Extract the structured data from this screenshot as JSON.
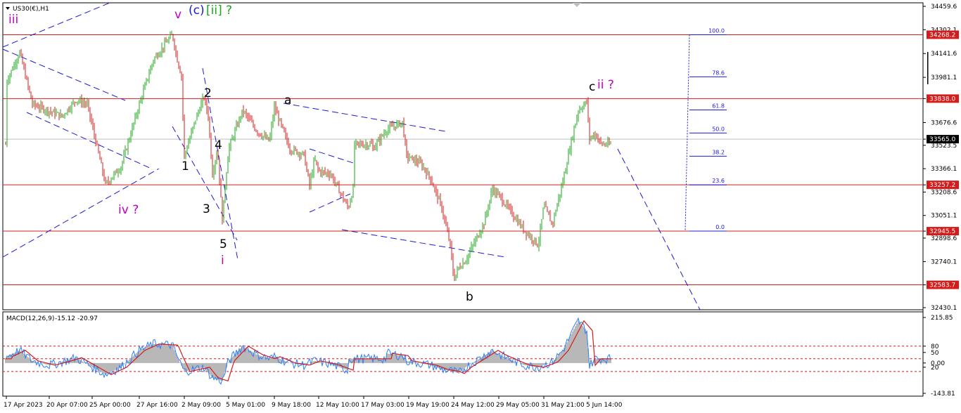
{
  "header": {
    "symbol": "US30(€),H1",
    "macd_label": "MACD(12,26,9)",
    "macd_value": "-15.12",
    "macd_signal": "-20.97"
  },
  "colors": {
    "bull": "#1aa81a",
    "bear": "#d41c1c",
    "level": "#d41c1c",
    "trend": "#1b1bd6",
    "price_badge": "#d41c1c",
    "current_badge": "#000000",
    "histogram": "#b8b8b8",
    "macd_line": "#2a7fff",
    "signal_line": "#d41c1c"
  },
  "chart_data": [
    {
      "type": "candlestick",
      "ylim": [
        32430.1,
        34459.6
      ],
      "y_ticks": [
        "34459.6",
        "34302.1",
        "34141.6",
        "33981.1",
        "33838.0",
        "33676.6",
        "33565.0",
        "33523.5",
        "33366.1",
        "33257.2",
        "33208.6",
        "33051.1",
        "32945.5",
        "32898.6",
        "32740.1",
        "32583.7",
        "32430.1"
      ],
      "x_ticks": [
        "17 Apr 2023",
        "20 Apr 07:00",
        "25 Apr 00:00",
        "27 Apr 16:00",
        "2 May 09:00",
        "5 May 01:00",
        "9 May 18:00",
        "12 May 10:00",
        "17 May 03:00",
        "19 May 19:00",
        "24 May 12:00",
        "29 May 05:00",
        "31 May 21:00",
        "5 Jun 14:00"
      ],
      "key_points": [
        {
          "x": "17 Apr 2023",
          "y": 33950
        },
        {
          "x": "18 Apr",
          "y": 34150
        },
        {
          "x": "19 Apr",
          "y": 33800
        },
        {
          "x": "21 Apr",
          "y": 33720
        },
        {
          "x": "24 Apr",
          "y": 33830
        },
        {
          "x": "25 Apr",
          "y": 33800
        },
        {
          "x": "26 Apr",
          "y": 33260
        },
        {
          "x": "27 Apr",
          "y": 33380
        },
        {
          "x": "27 Apr 16:00",
          "y": 33800
        },
        {
          "x": "28 Apr",
          "y": 34100
        },
        {
          "x": "1 May",
          "y": 34270
        },
        {
          "x": "1 May 12:00",
          "y": 34100
        },
        {
          "x": "2 May 06:00",
          "y": 33990
        },
        {
          "x": "2 May 09:00",
          "y": 33450
        },
        {
          "x": "2 May 16:00",
          "y": 33700
        },
        {
          "x": "3 May",
          "y": 33850
        },
        {
          "x": "3 May 08:00",
          "y": 33720
        },
        {
          "x": "3 May 18:00",
          "y": 33330
        },
        {
          "x": "4 May",
          "y": 33500
        },
        {
          "x": "4 May 10:00",
          "y": 33020
        },
        {
          "x": "4 May 18:00",
          "y": 33250
        },
        {
          "x": "5 May 01:00",
          "y": 33500
        },
        {
          "x": "5 May 12:00",
          "y": 33760
        },
        {
          "x": "8 May",
          "y": 33620
        },
        {
          "x": "9 May",
          "y": 33550
        },
        {
          "x": "9 May 18:00",
          "y": 33780
        },
        {
          "x": "10 May",
          "y": 33500
        },
        {
          "x": "11 May",
          "y": 33460
        },
        {
          "x": "11 May 18:00",
          "y": 33250
        },
        {
          "x": "12 May",
          "y": 33430
        },
        {
          "x": "12 May 10:00",
          "y": 33350
        },
        {
          "x": "15 May",
          "y": 33330
        },
        {
          "x": "16 May",
          "y": 33100
        },
        {
          "x": "16 May 12:00",
          "y": 33250
        },
        {
          "x": "17 May",
          "y": 33450
        },
        {
          "x": "17 May 12:00",
          "y": 33500
        },
        {
          "x": "18 May",
          "y": 33630
        },
        {
          "x": "18 May 12:00",
          "y": 33680
        },
        {
          "x": "19 May",
          "y": 33450
        },
        {
          "x": "19 May 12:00",
          "y": 33400
        },
        {
          "x": "22 May",
          "y": 33300
        },
        {
          "x": "23 May",
          "y": 33100
        },
        {
          "x": "23 May 12:00",
          "y": 32850
        },
        {
          "x": "24 May",
          "y": 32700
        },
        {
          "x": "24 May 12:00",
          "y": 32620
        },
        {
          "x": "25 May",
          "y": 32750
        },
        {
          "x": "25 May 12:00",
          "y": 33000
        },
        {
          "x": "26 May",
          "y": 33230
        },
        {
          "x": "29 May",
          "y": 33180
        },
        {
          "x": "29 May 12:00",
          "y": 33050
        },
        {
          "x": "30 May",
          "y": 32950
        },
        {
          "x": "30 May 12:00",
          "y": 32880
        },
        {
          "x": "31 May",
          "y": 32850
        },
        {
          "x": "31 May 12:00",
          "y": 32990
        },
        {
          "x": "31 May 21:00",
          "y": 33120
        },
        {
          "x": "1 Jun",
          "y": 33280
        },
        {
          "x": "1 Jun 12:00",
          "y": 33550
        },
        {
          "x": "2 Jun",
          "y": 33760
        },
        {
          "x": "2 Jun 12:00",
          "y": 33820
        },
        {
          "x": "5 Jun",
          "y": 33600
        },
        {
          "x": "5 Jun 08:00",
          "y": 33530
        },
        {
          "x": "5 Jun 14:00",
          "y": 33565
        }
      ],
      "horizontal_levels": [
        34268.2,
        33838.0,
        33257.2,
        32945.5,
        32583.7
      ],
      "current_price": 33565.0,
      "fibonacci": [
        "100.0",
        "78.6",
        "61.8",
        "50.0",
        "38.2",
        "23.6",
        "0.0"
      ],
      "wave_labels": [
        "iii",
        "v",
        "(c)",
        "[ii]",
        "?",
        "iv ?",
        "i",
        "1",
        "2",
        "3",
        "4",
        "5",
        "a",
        "b",
        "c",
        "ii ?"
      ]
    },
    {
      "type": "macd",
      "ylim": [
        -143.81,
        215.85
      ],
      "y_ticks": [
        "215.85",
        "80",
        "50",
        "0.00",
        "20",
        "-143.81"
      ],
      "key_points": [
        {
          "x": "17 Apr 2023",
          "y": 30
        },
        {
          "x": "18 Apr",
          "y": 60
        },
        {
          "x": "19 Apr",
          "y": 10
        },
        {
          "x": "20 Apr",
          "y": -10
        },
        {
          "x": "21 Apr",
          "y": 5
        },
        {
          "x": "24 Apr",
          "y": 25
        },
        {
          "x": "25 Apr",
          "y": -5
        },
        {
          "x": "26 Apr",
          "y": -55
        },
        {
          "x": "27 Apr",
          "y": -20
        },
        {
          "x": "27 Apr 16:00",
          "y": 60
        },
        {
          "x": "28 Apr",
          "y": 90
        },
        {
          "x": "1 May",
          "y": 85
        },
        {
          "x": "1 May 12:00",
          "y": 30
        },
        {
          "x": "2 May 09:00",
          "y": -40
        },
        {
          "x": "3 May",
          "y": -20
        },
        {
          "x": "3 May 18:00",
          "y": -70
        },
        {
          "x": "4 May 10:00",
          "y": -85
        },
        {
          "x": "5 May 01:00",
          "y": 10
        },
        {
          "x": "5 May 12:00",
          "y": 80
        },
        {
          "x": "8 May",
          "y": 40
        },
        {
          "x": "9 May",
          "y": 20
        },
        {
          "x": "9 May 18:00",
          "y": 30
        },
        {
          "x": "10 May",
          "y": 0
        },
        {
          "x": "11 May",
          "y": -10
        },
        {
          "x": "12 May",
          "y": 10
        },
        {
          "x": "15 May",
          "y": -5
        },
        {
          "x": "16 May",
          "y": -35
        },
        {
          "x": "17 May",
          "y": 10
        },
        {
          "x": "18 May",
          "y": 45
        },
        {
          "x": "18 May 12:00",
          "y": 35
        },
        {
          "x": "19 May",
          "y": 10
        },
        {
          "x": "22 May",
          "y": -10
        },
        {
          "x": "23 May",
          "y": -30
        },
        {
          "x": "24 May",
          "y": -50
        },
        {
          "x": "24 May 12:00",
          "y": -40
        },
        {
          "x": "25 May",
          "y": -20
        },
        {
          "x": "26 May",
          "y": 60
        },
        {
          "x": "29 May",
          "y": 40
        },
        {
          "x": "29 May 12:00",
          "y": 10
        },
        {
          "x": "30 May",
          "y": -10
        },
        {
          "x": "31 May",
          "y": -20
        },
        {
          "x": "31 May 12:00",
          "y": 5
        },
        {
          "x": "1 Jun",
          "y": 60
        },
        {
          "x": "2 Jun",
          "y": 200
        },
        {
          "x": "2 Jun 12:00",
          "y": 150
        },
        {
          "x": "5 Jun",
          "y": 20
        },
        {
          "x": "5 Jun 14:00",
          "y": -15
        }
      ]
    }
  ]
}
